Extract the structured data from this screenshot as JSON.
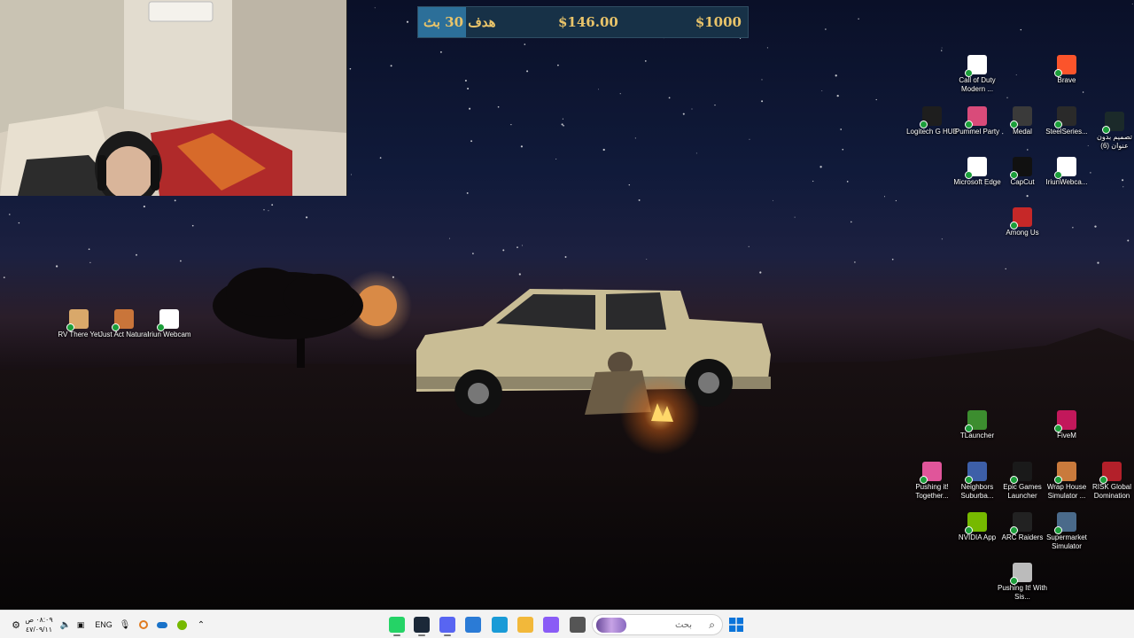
{
  "goal": {
    "label": "هدف 30 بث",
    "current": "$146.00",
    "target": "$1000",
    "progress_fraction": 0.146,
    "colors": {
      "bar": "#173147",
      "fill": "#2c6f99",
      "text": "#e9c46a"
    }
  },
  "desktop_icons_right": [
    {
      "label": "Call of Duty Modern ...",
      "icon": "document-icon",
      "color": "#ffffff"
    },
    {
      "label": "Brave",
      "icon": "brave-lion-icon",
      "color": "#fb542b"
    },
    {
      "label": "Logitech G HUB",
      "icon": "logitech-g-icon",
      "color": "#1e1e1e"
    },
    {
      "label": "Pummel Party",
      "icon": "pummel-party-icon",
      "color": "#d94b7a"
    },
    {
      "label": "Medal",
      "icon": "medal-icon",
      "color": "#3a3a3a"
    },
    {
      "label": "SteelSeries...",
      "icon": "steelseries-icon",
      "color": "#2a2a2a"
    },
    {
      "label": "تصميم بدون عنوان (6)",
      "icon": "design-file-icon",
      "color": "#1b2a2a"
    },
    {
      "label": "Microsoft Edge",
      "icon": "document-icon",
      "color": "#ffffff"
    },
    {
      "label": "CapCut",
      "icon": "capcut-icon",
      "color": "#111111"
    },
    {
      "label": "IriunWebca...",
      "icon": "iriun-webcam-icon",
      "color": "#ffffff"
    },
    {
      "label": "Among Us",
      "icon": "among-us-icon",
      "color": "#c62828"
    },
    {
      "label": "TLauncher",
      "icon": "tlauncher-icon",
      "color": "#3c8d2f"
    },
    {
      "label": "FiveM",
      "icon": "fivem-icon",
      "color": "#c2185b"
    },
    {
      "label": "Pushing it! Together...",
      "icon": "pushing-it-icon",
      "color": "#e0559a"
    },
    {
      "label": "Neighbors Suburba...",
      "icon": "neighbors-icon",
      "color": "#3d5fa8"
    },
    {
      "label": "Epic Games Launcher",
      "icon": "epic-games-icon",
      "color": "#1a1a1a"
    },
    {
      "label": "Wrap House Simulator ...",
      "icon": "wrap-house-icon",
      "color": "#c97a3c"
    },
    {
      "label": "RISK Global Domination",
      "icon": "risk-icon",
      "color": "#b3202a"
    },
    {
      "label": "NVIDIA App",
      "icon": "nvidia-icon",
      "color": "#76b900"
    },
    {
      "label": "ARC Raiders",
      "icon": "arc-raiders-icon",
      "color": "#222222"
    },
    {
      "label": "Supermarket Simulator",
      "icon": "supermarket-icon",
      "color": "#4a6a8a"
    },
    {
      "label": "Pushing It! With Sis...",
      "icon": "pushing-it-sis-icon",
      "color": "#bbbbbb"
    }
  ],
  "desktop_icons_left": [
    {
      "label": "RV There Yet",
      "icon": "rv-there-yet-icon",
      "color": "#d9a86a"
    },
    {
      "label": "Just Act Natural",
      "icon": "just-act-natural-icon",
      "color": "#c9753a"
    },
    {
      "label": "Iriun Webcam",
      "icon": "iriun-webcam-icon",
      "color": "#ffffff"
    }
  ],
  "taskbar": {
    "clock_time": "٠٨:٠٩ ص",
    "clock_date": "٤٧/٠٩/١١",
    "language": "ENG",
    "search_placeholder": "بحث",
    "apps": [
      {
        "name": "whatsapp-app",
        "color": "#25d366",
        "active": true
      },
      {
        "name": "steam-app",
        "color": "#1b2838",
        "active": true
      },
      {
        "name": "discord-app",
        "color": "#5865f2",
        "active": true
      },
      {
        "name": "store-app",
        "color": "#2b7bd6",
        "active": false
      },
      {
        "name": "edge-app",
        "color": "#1a9bd7",
        "active": false
      },
      {
        "name": "file-explorer-app",
        "color": "#f2b83a",
        "active": false
      },
      {
        "name": "copilot-app",
        "color": "#8a5cf6",
        "active": false
      },
      {
        "name": "task-view-app",
        "color": "#555555",
        "active": false
      }
    ]
  }
}
